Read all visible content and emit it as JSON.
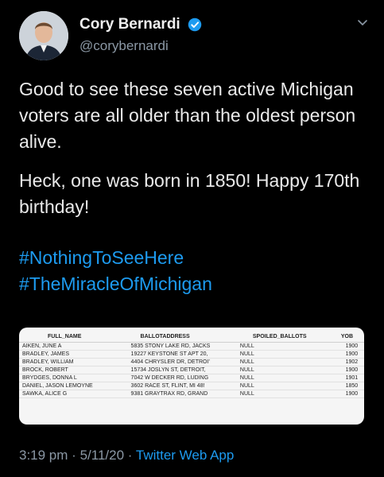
{
  "user": {
    "display_name": "Cory Bernardi",
    "handle": "@corybernardi",
    "avatar_icon": "person-avatar",
    "verified_icon": "verified-badge-icon",
    "verified_color": "#1d9bf0"
  },
  "tweet": {
    "paragraphs": [
      "Good to see these seven active Michigan voters are all older than the oldest person alive.",
      "Heck, one was born in 1850! Happy 170th birthday!"
    ],
    "hashtags": [
      "#NothingToSeeHere",
      "#TheMiracleOfMichigan"
    ],
    "link_color": "#1d9bf0"
  },
  "table": {
    "columns": [
      "FULL_NAME",
      "BALLOTADDRESS",
      "SPOILED_BALLOTS",
      "YOB"
    ],
    "rows": [
      [
        "AIKEN, JUNE A",
        "5835 STONY LAKE RD, JACKS",
        "NULL",
        "1900"
      ],
      [
        "BRADLEY, JAMES",
        "19227 KEYSTONE ST APT 20,",
        "NULL",
        "1900"
      ],
      [
        "BRADLEY, WILLIAM",
        "4404 CHRYSLER DR, DETROI'",
        "NULL",
        "1902"
      ],
      [
        "BROCK, ROBERT",
        "15734 JOSLYN ST, DETROIT,",
        "NULL",
        "1900"
      ],
      [
        "BRYDGES, DONNA L",
        "7042 W DECKER RD, LUDING",
        "NULL",
        "1901"
      ],
      [
        "DANIEL, JASON LEMOYNE",
        "3602 RACE ST, FLINT, MI 48!",
        "NULL",
        "1850"
      ],
      [
        "SAWKA, ALICE G",
        "9381 GRAYTRAX RD, GRAND",
        "NULL",
        "1900"
      ]
    ]
  },
  "footer": {
    "time": "3:19 pm",
    "date": "5/11/20",
    "separator": "·",
    "source": "Twitter Web App"
  }
}
